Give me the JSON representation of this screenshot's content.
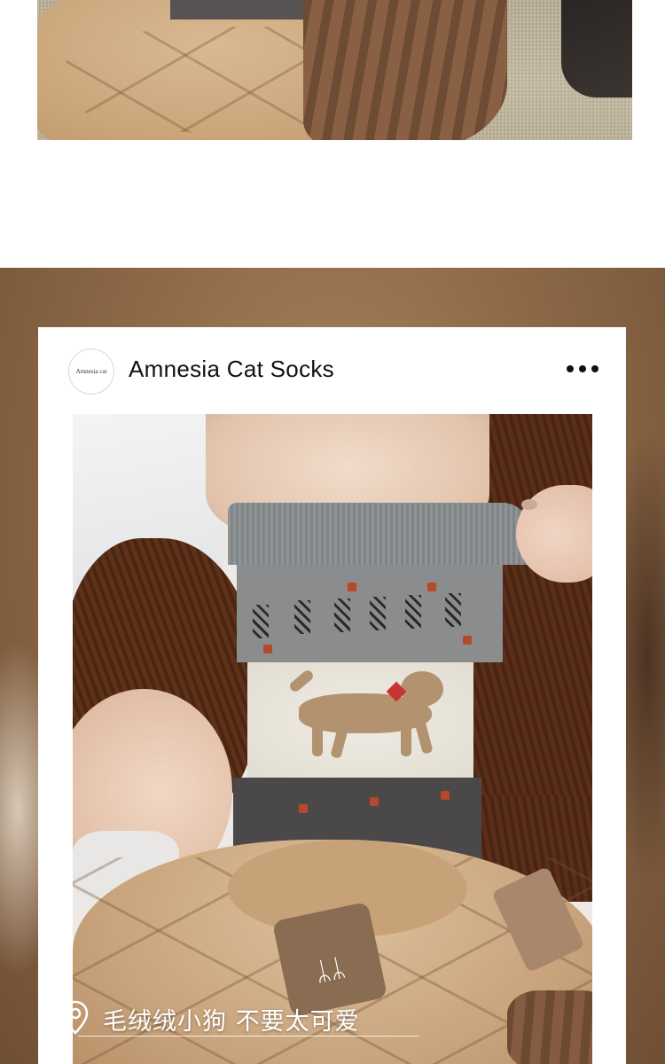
{
  "post": {
    "avatar_text": "Amnesia cat",
    "brand_name": "Amnesia Cat Socks",
    "more_icon": "more-horizontal-icon"
  },
  "caption": {
    "icon": "location-pin-icon",
    "text": "毛绒绒小狗 不要太可爱"
  },
  "colors": {
    "card_background": "#ffffff",
    "caption_text": "#ffffff",
    "brand_text": "#111111"
  }
}
